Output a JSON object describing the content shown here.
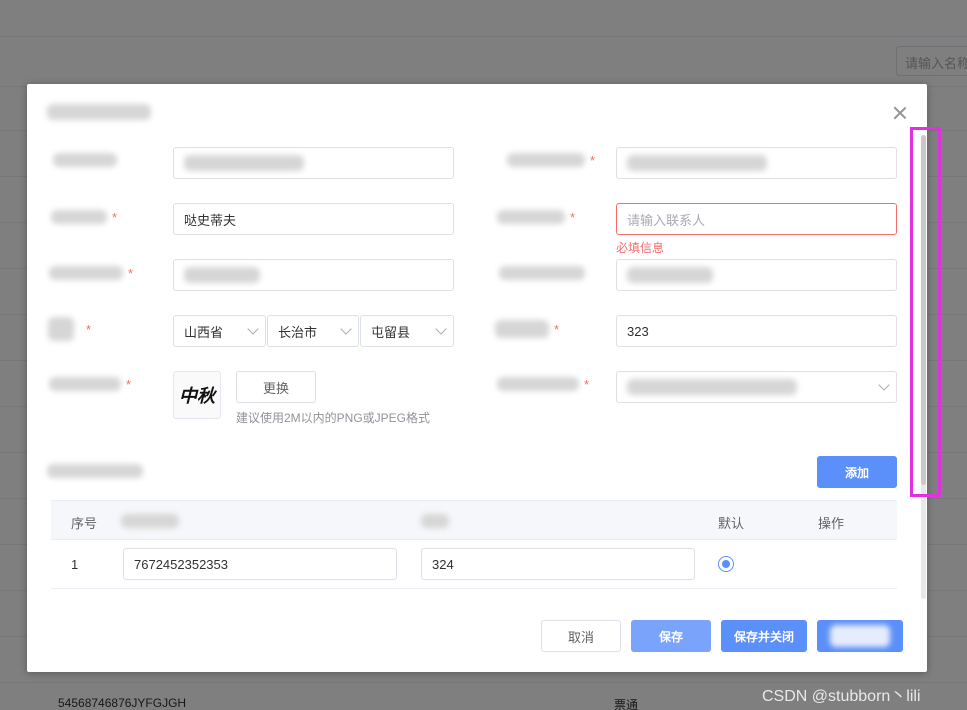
{
  "background": {
    "search_placeholder": "请输入名称",
    "row_left": "54568746876JYFGJGH",
    "row_right": "票通"
  },
  "dialog": {
    "fields": {
      "contact_name_value": "哒史蒂夫",
      "contact_placeholder": "请输入联系人",
      "required_error": "必填信息",
      "province": "山西省",
      "city": "长治市",
      "county": "屯留县",
      "right_number_value": "323",
      "logo_glyph": "中秋",
      "replace_button": "更换",
      "logo_hint": "建议使用2M以内的PNG或JPEG格式"
    },
    "table": {
      "add_button": "添加",
      "headers": {
        "index": "序号",
        "default": "默认",
        "action": "操作"
      },
      "rows": [
        {
          "index": "1",
          "col1": "7672452352353",
          "col2": "324",
          "default": true
        }
      ]
    },
    "footer": {
      "cancel": "取消",
      "save": "保存",
      "save_close": "保存并关闭"
    }
  },
  "watermark": "CSDN @stubborn丶lili",
  "colors": {
    "primary": "#5b8ff9",
    "error": "#f56c6c",
    "highlight_box": "#e030e0"
  }
}
